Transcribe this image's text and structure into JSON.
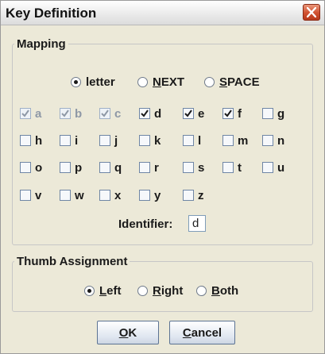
{
  "window": {
    "title": "Key Definition"
  },
  "mapping": {
    "legend": "Mapping",
    "modes": [
      {
        "label": "letter",
        "selected": true
      },
      {
        "label_mn": "N",
        "label_rest": "EXT",
        "selected": false
      },
      {
        "label_mn": "S",
        "label_rest": "PACE",
        "selected": false
      }
    ],
    "letters": [
      {
        "label": "a",
        "checked": true,
        "enabled": false
      },
      {
        "label": "b",
        "checked": true,
        "enabled": false
      },
      {
        "label": "c",
        "checked": true,
        "enabled": false
      },
      {
        "label": "d",
        "checked": true,
        "enabled": true
      },
      {
        "label": "e",
        "checked": true,
        "enabled": true
      },
      {
        "label": "f",
        "checked": true,
        "enabled": true
      },
      {
        "label": "g",
        "checked": false,
        "enabled": true
      },
      {
        "label": "h",
        "checked": false,
        "enabled": true
      },
      {
        "label": "i",
        "checked": false,
        "enabled": true
      },
      {
        "label": "j",
        "checked": false,
        "enabled": true
      },
      {
        "label": "k",
        "checked": false,
        "enabled": true
      },
      {
        "label": "l",
        "checked": false,
        "enabled": true
      },
      {
        "label": "m",
        "checked": false,
        "enabled": true
      },
      {
        "label": "n",
        "checked": false,
        "enabled": true
      },
      {
        "label": "o",
        "checked": false,
        "enabled": true
      },
      {
        "label": "p",
        "checked": false,
        "enabled": true
      },
      {
        "label": "q",
        "checked": false,
        "enabled": true
      },
      {
        "label": "r",
        "checked": false,
        "enabled": true
      },
      {
        "label": "s",
        "checked": false,
        "enabled": true
      },
      {
        "label": "t",
        "checked": false,
        "enabled": true
      },
      {
        "label": "u",
        "checked": false,
        "enabled": true
      },
      {
        "label": "v",
        "checked": false,
        "enabled": true
      },
      {
        "label": "w",
        "checked": false,
        "enabled": true
      },
      {
        "label": "x",
        "checked": false,
        "enabled": true
      },
      {
        "label": "y",
        "checked": false,
        "enabled": true
      },
      {
        "label": "z",
        "checked": false,
        "enabled": true
      }
    ],
    "identifier_label": "Identifier:",
    "identifier_value": "d"
  },
  "thumb": {
    "legend": "Thumb Assignment",
    "options": [
      {
        "label_mn": "L",
        "label_rest": "eft",
        "selected": true
      },
      {
        "label_mn": "R",
        "label_rest": "ight",
        "selected": false
      },
      {
        "label_mn": "B",
        "label_rest": "oth",
        "selected": false
      }
    ]
  },
  "buttons": {
    "ok_mn": "O",
    "ok_rest": "K",
    "cancel_mn": "C",
    "cancel_rest": "ancel"
  },
  "colors": {
    "close_button": "#d0502f",
    "check_mark": "#1a1a1a",
    "disabled_text": "#8e98a6"
  },
  "icons": {
    "close": "close-x-icon",
    "check": "checkmark-icon"
  }
}
